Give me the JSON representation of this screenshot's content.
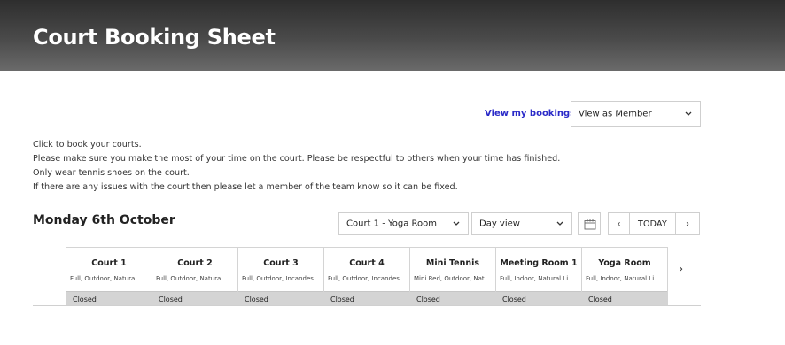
{
  "header": {
    "title": "Court Booking Sheet"
  },
  "toolbar": {
    "view_bookings_link": "View my bookings >",
    "view_as_selected": "View as Member"
  },
  "intro_lines": [
    "Click to book your courts.",
    "Please make sure you make the most of your time on the court. Please be respectful to others when your time has finished.",
    "Only wear tennis shoes on the court.",
    "If there are any issues with the court then please let a member of the team know so it can be fixed."
  ],
  "schedule": {
    "date_heading": "Monday 6th October",
    "court_select_value": "Court 1 - Yoga Room",
    "view_select_value": "Day view",
    "today_label": "TODAY",
    "prev_label": "‹",
    "next_label": "›"
  },
  "courts": [
    {
      "name": "Court 1",
      "desc": "Full, Outdoor, Natural Grass",
      "status": "Closed"
    },
    {
      "name": "Court 2",
      "desc": "Full, Outdoor, Natural Grass",
      "status": "Closed"
    },
    {
      "name": "Court 3",
      "desc": "Full, Outdoor, Incandescent",
      "status": "Closed"
    },
    {
      "name": "Court 4",
      "desc": "Full, Outdoor, Incandescent",
      "status": "Closed"
    },
    {
      "name": "Mini Tennis",
      "desc": "Mini Red, Outdoor, Natural",
      "status": "Closed"
    },
    {
      "name": "Meeting Room 1",
      "desc": "Full, Indoor, Natural Light",
      "status": "Closed"
    },
    {
      "name": "Yoga Room",
      "desc": "Full, Indoor, Natural Light",
      "status": "Closed"
    }
  ],
  "courts_next_label": "›",
  "icons": {
    "dropdown": "chevron-down-icon",
    "calendar": "calendar-icon"
  }
}
